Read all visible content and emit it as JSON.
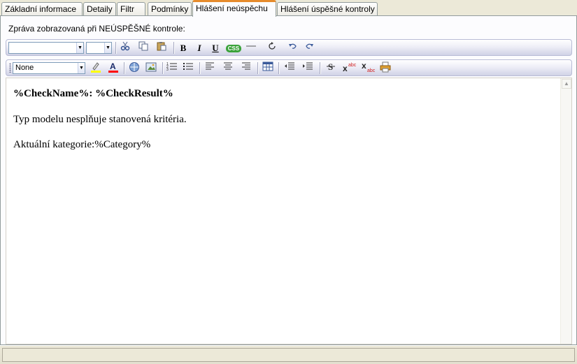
{
  "tabs": [
    {
      "label": "Základní informace",
      "active": false
    },
    {
      "label": "Detaily",
      "active": false
    },
    {
      "label": "Filtr",
      "active": false
    },
    {
      "label": "Podmínky",
      "active": false
    },
    {
      "label": "Hlášení neúspěchu",
      "active": true
    },
    {
      "label": "Hlášení úspěšné kontroly",
      "active": false
    }
  ],
  "panel": {
    "message_label": "Zpráva zobrazovaná při NEÚSPĚŠNÉ kontrole:"
  },
  "toolbar1": {
    "font_family_value": "",
    "font_size_value": "",
    "css_label": "CSS",
    "bold_label": "B",
    "italic_label": "I",
    "underline_label": "U"
  },
  "toolbar2": {
    "paragraph_style_value": "None"
  },
  "editor": {
    "title": "%CheckName%: %CheckResult%",
    "line1": "Typ modelu nesplňuje stanovená kritéria.",
    "line2": "Aktuální kategorie:%Category%"
  },
  "colors": {
    "active_tab_accent": "#e68b2c",
    "toolbar_gradient_end": "#d0d2e6",
    "css_badge": "#3aa23a",
    "highlight_color": "#ffff00",
    "font_color": "#ff0000"
  }
}
